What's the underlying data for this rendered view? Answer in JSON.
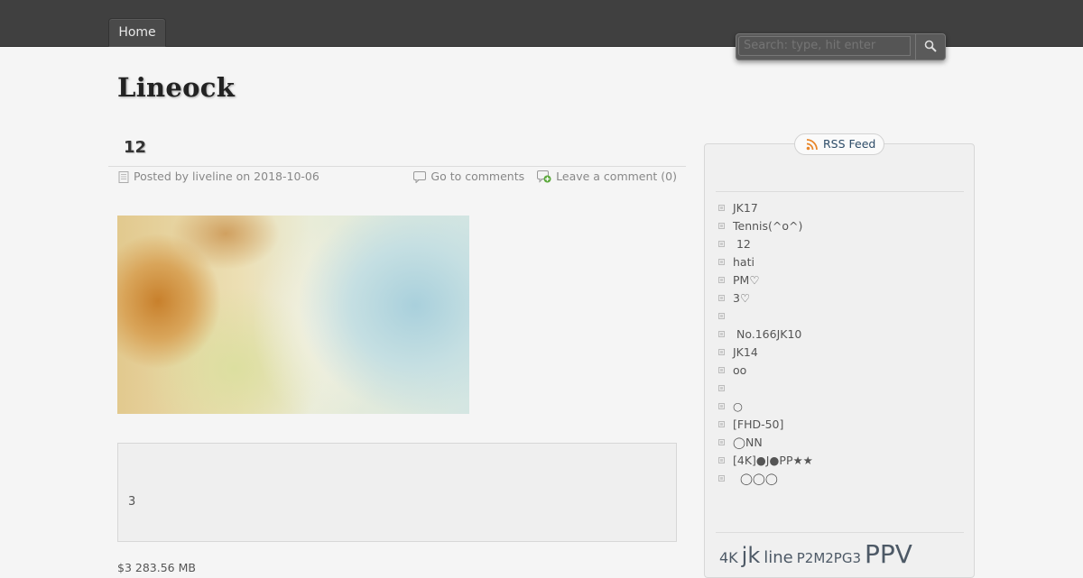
{
  "nav": {
    "home_label": "Home"
  },
  "search": {
    "placeholder": "Search: type, hit enter"
  },
  "site": {
    "title": "Lineock"
  },
  "post": {
    "title": "12",
    "posted_by": "Posted by liveline on 2018-10-06",
    "go_to_comments": "Go to comments",
    "leave_comment": "Leave a comment (0)",
    "quote_text": "3",
    "trailing_text": "$3    283.56 MB"
  },
  "sidebar": {
    "rss_label": "RSS Feed",
    "recent_posts": [
      "JK17",
      "Tennis(^o^)",
      " 12",
      "hati",
      "PM♡",
      "3♡",
      "",
      " No.166JK10",
      "JK14",
      "oo",
      "",
      "○",
      "[FHD-50]",
      "◯NN",
      "[4K]●J●PP★★",
      "  ◯◯◯"
    ],
    "tags": [
      {
        "label": "4K",
        "size": 16
      },
      {
        "label": "jk",
        "size": 24
      },
      {
        "label": "line",
        "size": 18
      },
      {
        "label": "P2M2PG3",
        "size": 15
      },
      {
        "label": "PPV",
        "size": 28
      }
    ]
  },
  "colors": {
    "topbar": "#404040",
    "background": "#f5f5f5",
    "rss_text": "#2d4c68",
    "rss_icon": "#e8862a"
  }
}
